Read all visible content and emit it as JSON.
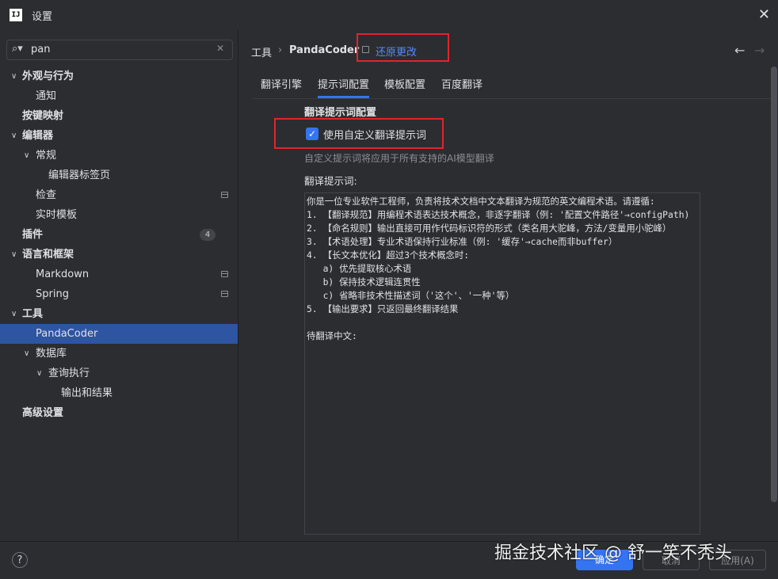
{
  "window": {
    "title": "设置",
    "app_logo": "IJ"
  },
  "search": {
    "value": "pan"
  },
  "sidebar": {
    "items": [
      {
        "label": "外观与行为",
        "level": 0,
        "chevron": "expanded",
        "bold": true
      },
      {
        "label": "通知",
        "level": 1
      },
      {
        "label": "按键映射",
        "level": 0,
        "bold": true
      },
      {
        "label": "编辑器",
        "level": 0,
        "chevron": "expanded",
        "bold": true
      },
      {
        "label": "常规",
        "level": 1,
        "chevron": "expanded"
      },
      {
        "label": "编辑器标签页",
        "level": 2
      },
      {
        "label": "检查",
        "level": 1,
        "project_icon": true
      },
      {
        "label": "实时模板",
        "level": 1
      },
      {
        "label": "插件",
        "level": 0,
        "bold": true,
        "badge": "4"
      },
      {
        "label": "语言和框架",
        "level": 0,
        "chevron": "expanded",
        "bold": true
      },
      {
        "label": "Markdown",
        "level": 1,
        "project_icon": true
      },
      {
        "label": "Spring",
        "level": 1,
        "project_icon": true
      },
      {
        "label": "工具",
        "level": 0,
        "chevron": "expanded",
        "bold": true
      },
      {
        "label": "PandaCoder",
        "level": 1,
        "selected": true
      },
      {
        "label": "数据库",
        "level": 1,
        "chevron": "expanded"
      },
      {
        "label": "查询执行",
        "level": 2,
        "chevron": "expanded"
      },
      {
        "label": "输出和结果",
        "level": 3
      },
      {
        "label": "高级设置",
        "level": 0,
        "bold": true
      }
    ]
  },
  "breadcrumb": {
    "parent": "工具",
    "separator": "›",
    "current": "PandaCoder",
    "revert": "还原更改"
  },
  "tabs": [
    {
      "label": "翻译引擎",
      "active": false
    },
    {
      "label": "提示词配置",
      "active": true
    },
    {
      "label": "模板配置",
      "active": false
    },
    {
      "label": "百度翻译",
      "active": false
    }
  ],
  "content": {
    "section_title": "翻译提示词配置",
    "checkbox_label": "使用自定义翻译提示词",
    "checkbox_checked": true,
    "hint": "自定义提示词将应用于所有支持的AI模型翻译",
    "field_label": "翻译提示词:",
    "prompt": "你是一位专业软件工程师，负责将技术文档中文本翻译为规范的英文编程术语。请遵循:\n1. 【翻译规范】用编程术语表达技术概念，非逐字翻译（例: '配置文件路径'→configPath)\n2. 【命名规则】输出直接可用作代码标识符的形式（类名用大驼峰，方法/变量用小驼峰）\n3. 【术语处理】专业术语保持行业标准（例: '缓存'→cache而非buffer）\n4. 【长文本优化】超过3个技术概念时:\n   a) 优先提取核心术语\n   b) 保持技术逻辑连贯性\n   c) 省略非技术性描述词（'这个'、'一种'等）\n5. 【输出要求】只返回最终翻译结果\n\n待翻译中文:"
  },
  "buttons": {
    "help": "?",
    "ok": "确定",
    "cancel": "取消",
    "apply": "应用(A)"
  },
  "watermark": "掘金技术社区 @ 舒一笑不秃头",
  "colors": {
    "accent": "#3574f0",
    "highlight_box": "#e0252b",
    "background": "#2b2d30",
    "selection": "#2e55a2"
  }
}
